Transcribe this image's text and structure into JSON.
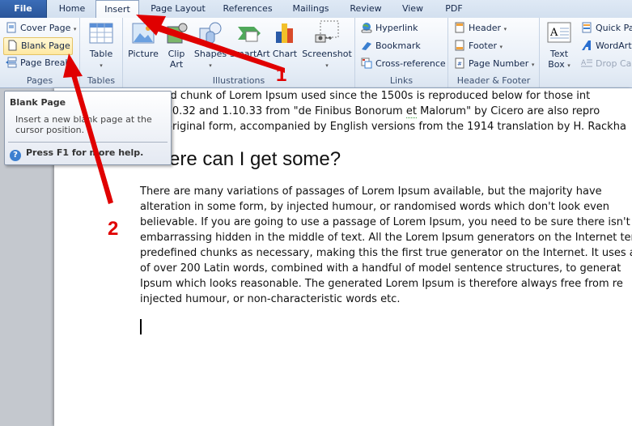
{
  "tabs": [
    {
      "label": "File"
    },
    {
      "label": "Home"
    },
    {
      "label": "Insert",
      "active": true
    },
    {
      "label": "Page Layout"
    },
    {
      "label": "References"
    },
    {
      "label": "Mailings"
    },
    {
      "label": "Review"
    },
    {
      "label": "View"
    },
    {
      "label": "PDF"
    }
  ],
  "ribbon": {
    "pages": {
      "label": "Pages",
      "cover_page": "Cover Page",
      "blank_page": "Blank Page",
      "page_break": "Page Break"
    },
    "tables": {
      "label": "Tables",
      "table": "Table"
    },
    "illustrations": {
      "label": "Illustrations",
      "picture": "Picture",
      "clip_art_1": "Clip",
      "clip_art_2": "Art",
      "shapes": "Shapes",
      "smartart": "SmartArt",
      "chart": "Chart",
      "screenshot": "Screenshot"
    },
    "links": {
      "label": "Links",
      "hyperlink": "Hyperlink",
      "bookmark": "Bookmark",
      "cross_reference": "Cross-reference"
    },
    "header_footer": {
      "label": "Header & Footer",
      "header": "Header",
      "footer": "Footer",
      "page_number": "Page Number"
    },
    "text": {
      "text_box_1": "Text",
      "text_box_2": "Box",
      "quick_parts": "Quick Pa",
      "wordart": "WordArt",
      "drop_cap": "Drop Cap"
    },
    "dropdown_glyph": "▾"
  },
  "tooltip": {
    "title": "Blank Page",
    "body": "Insert a new blank page at the cursor position.",
    "help": "Press F1 for more help.",
    "help_icon": "?"
  },
  "document": {
    "top_lines": [
      "andard chunk of Lorem Ipsum used since the 1500s is reproduced below for those int",
      "ns 1.10.32 and 1.10.33 from \"de Finibus Bonorum ",
      "xact original form, accompanied by English versions from the 1914 translation by H. Rackha"
    ],
    "line2_squiggle": "et",
    "line2_tail": " Malorum\" by Cicero are also repro",
    "heading": "Where can I get some?",
    "paragraph_lines": [
      "There are many variations of passages of Lorem Ipsum available, but the majority have",
      "alteration in some form, by injected humour, or randomised words which don't look even",
      "believable. If you are going to use a passage of Lorem Ipsum, you need to be sure there isn't",
      "embarrassing hidden in the middle of text. All the Lorem Ipsum generators on the Internet tend t",
      "predefined chunks as necessary, making this the first true generator on the Internet. It uses a d",
      "of over 200 Latin words, combined with a handful of model sentence structures, to generat",
      "Ipsum which looks reasonable. The generated Lorem Ipsum is therefore always free from re",
      "injected humour, or non-characteristic words etc."
    ]
  },
  "annotations": {
    "step1": "1",
    "step2": "2",
    "color": "#e00000"
  }
}
